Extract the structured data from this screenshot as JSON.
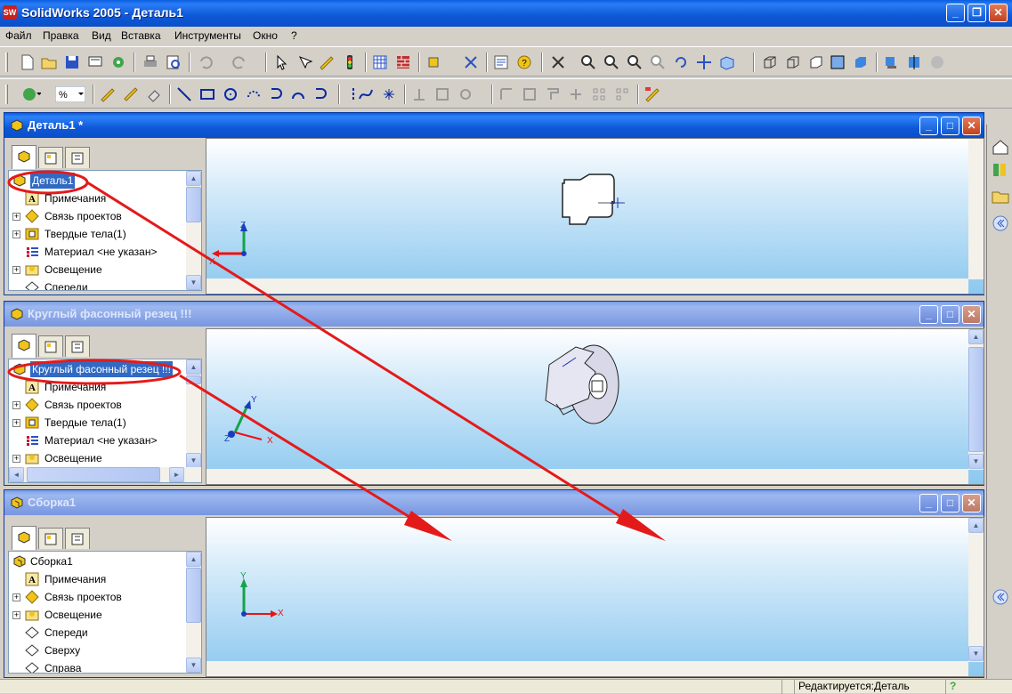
{
  "app": {
    "title": "SolidWorks 2005 - Деталь1",
    "logo": "SW"
  },
  "menu": [
    "Файл",
    "Правка",
    "Вид",
    "Вставка",
    "Инструменты",
    "Окно",
    "?"
  ],
  "window1": {
    "title": "Деталь1 *",
    "tree": [
      {
        "label": "Деталь1",
        "icon": "part-icon",
        "root": true,
        "selected": true
      },
      {
        "label": "Примечания",
        "icon": "annotation-icon"
      },
      {
        "label": "Связь проектов",
        "icon": "design-binder-icon",
        "expand": true
      },
      {
        "label": "Твердые тела(1)",
        "icon": "solid-bodies-icon",
        "expand": true
      },
      {
        "label": "Материал <не указан>",
        "icon": "material-icon"
      },
      {
        "label": "Освещение",
        "icon": "lighting-icon",
        "expand": true
      },
      {
        "label": "Спереди",
        "icon": "plane-icon"
      }
    ]
  },
  "window2": {
    "title": "Круглый фасонный резец !!!",
    "tree": [
      {
        "label": "Круглый фасонный резец !!!",
        "icon": "part-icon",
        "root": true,
        "selected": true
      },
      {
        "label": "Примечания",
        "icon": "annotation-icon"
      },
      {
        "label": "Связь проектов",
        "icon": "design-binder-icon",
        "expand": true
      },
      {
        "label": "Твердые тела(1)",
        "icon": "solid-bodies-icon",
        "expand": true
      },
      {
        "label": "Материал <не указан>",
        "icon": "material-icon"
      },
      {
        "label": "Освещение",
        "icon": "lighting-icon",
        "expand": true
      }
    ]
  },
  "window3": {
    "title": "Сборка1",
    "tree": [
      {
        "label": "Сборка1",
        "icon": "assembly-icon",
        "root": true
      },
      {
        "label": "Примечания",
        "icon": "annotation-icon"
      },
      {
        "label": "Связь проектов",
        "icon": "design-binder-icon",
        "expand": true
      },
      {
        "label": "Освещение",
        "icon": "lighting-icon",
        "expand": true
      },
      {
        "label": "Спереди",
        "icon": "plane-icon"
      },
      {
        "label": "Сверху",
        "icon": "plane-icon"
      },
      {
        "label": "Справа",
        "icon": "plane-icon"
      }
    ]
  },
  "axes": {
    "x": "X",
    "y": "Y",
    "z": "Z"
  },
  "status": {
    "mode": "Редактируется:Деталь",
    "help": "?"
  },
  "colors": {
    "annotation": "#e41a1a",
    "titlebar": "#0a5ee0"
  }
}
